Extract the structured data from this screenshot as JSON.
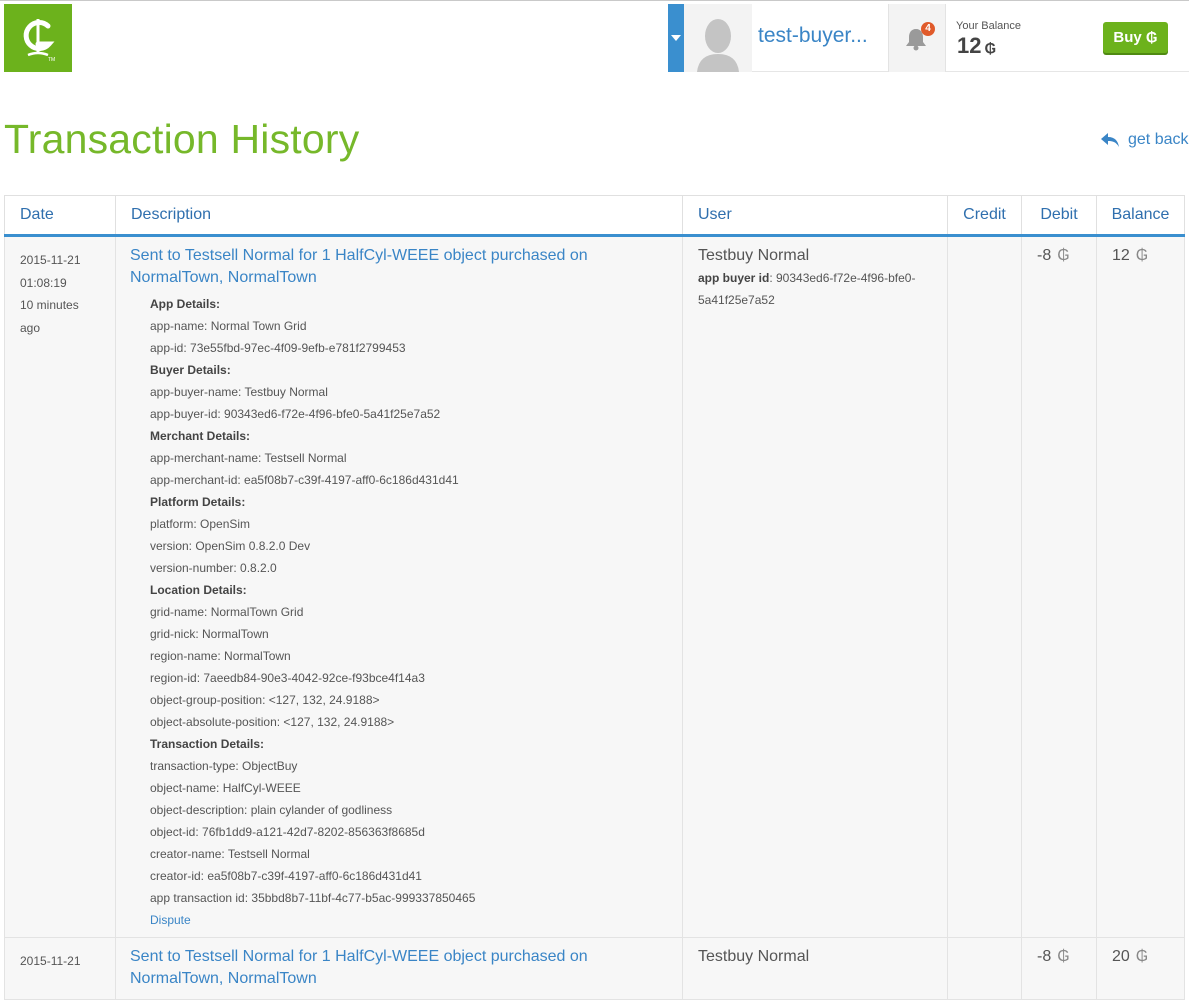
{
  "header": {
    "username": "test-buyer...",
    "notification_count": "4",
    "balance_label": "Your Balance",
    "balance_value": "12",
    "currency_symbol": "₲",
    "buy_label": "Buy ₲",
    "brand_color": "#6cb21c",
    "accent_color": "#3a8fcf"
  },
  "page": {
    "title": "Transaction History",
    "back_label": "get back"
  },
  "table": {
    "headers": {
      "date": "Date",
      "description": "Description",
      "user": "User",
      "credit": "Credit",
      "debit": "Debit",
      "balance": "Balance"
    },
    "rows": [
      {
        "date": "2015-11-21",
        "time": "01:08:19",
        "ago_1": "10 minutes",
        "ago_2": "ago",
        "description": "Sent to Testsell Normal for 1 HalfCyl-WEEE object purchased on NormalTown, NormalTown",
        "details": {
          "app_details": "App Details:",
          "app_name": "app-name: Normal Town Grid",
          "app_id": "app-id: 73e55fbd-97ec-4f09-9efb-e781f2799453",
          "buyer_details": "Buyer Details:",
          "app_buyer_name": "app-buyer-name: Testbuy Normal",
          "app_buyer_id": "app-buyer-id: 90343ed6-f72e-4f96-bfe0-5a41f25e7a52",
          "merchant_details": "Merchant Details:",
          "app_merchant_name": "app-merchant-name: Testsell Normal",
          "app_merchant_id": "app-merchant-id: ea5f08b7-c39f-4197-aff0-6c186d431d41",
          "platform_details": "Platform Details:",
          "platform": "platform: OpenSim",
          "version": "version: OpenSim 0.8.2.0 Dev",
          "version_number": "version-number: 0.8.2.0",
          "location_details": "Location Details:",
          "grid_name": "grid-name: NormalTown Grid",
          "grid_nick": "grid-nick: NormalTown",
          "region_name": "region-name: NormalTown",
          "region_id": "region-id: 7aeedb84-90e3-4042-92ce-f93bce4f14a3",
          "object_group_position": "object-group-position: <127, 132, 24.9188>",
          "object_absolute_position": "object-absolute-position: <127, 132, 24.9188>",
          "transaction_details": "Transaction Details:",
          "transaction_type": "transaction-type: ObjectBuy",
          "object_name": "object-name: HalfCyl-WEEE",
          "object_description": "object-description: plain cylander of godliness",
          "object_id": "object-id: 76fb1dd9-a121-42d7-8202-856363f8685d",
          "creator_name": "creator-name: Testsell Normal",
          "creator_id": "creator-id: ea5f08b7-c39f-4197-aff0-6c186d431d41",
          "app_transaction_id": "app transaction id: 35bbd8b7-11bf-4c77-b5ac-999337850465",
          "dispute_label": "Dispute"
        },
        "user_name": "Testbuy Normal",
        "user_id_label": "app buyer id",
        "user_id_value": ": 90343ed6-f72e-4f96-bfe0-5a41f25e7a52",
        "credit": "",
        "debit": "-8",
        "balance": "12"
      },
      {
        "date": "2015-11-21",
        "description": "Sent to Testsell Normal for 1 HalfCyl-WEEE object purchased on NormalTown, NormalTown",
        "user_name": "Testbuy Normal",
        "credit": "",
        "debit": "-8",
        "balance": "20"
      }
    ]
  }
}
